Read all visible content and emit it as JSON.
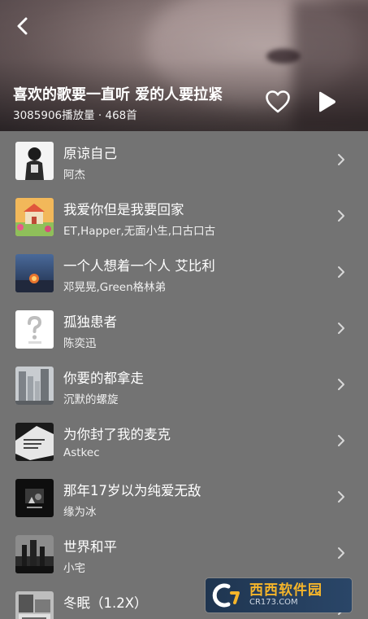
{
  "header": {
    "title": "喜欢的歌要一直听 爱的人要拉紧",
    "play_count": "3085906播放量",
    "separator": " · ",
    "track_count": "468首"
  },
  "songs": [
    {
      "title": "原谅自己",
      "artist": "阿杰"
    },
    {
      "title": "我爱你但是我要回家",
      "artist": "ET,Happer,无面小生,口古口古"
    },
    {
      "title": "一个人想着一个人 艾比利",
      "artist": "邓晃晃,Green格林弟"
    },
    {
      "title": "孤独患者",
      "artist": "陈奕迅"
    },
    {
      "title": "你要的都拿走",
      "artist": "沉默的螺旋"
    },
    {
      "title": "为你封了我的麦克",
      "artist": "Astkec"
    },
    {
      "title": "那年17岁以为纯爱无敌",
      "artist": "缘为冰"
    },
    {
      "title": "世界和平",
      "artist": "小宅"
    },
    {
      "title": "冬眠（1.2X）",
      "artist": ""
    }
  ],
  "watermark": {
    "main": "西西软件园",
    "sub": "CR173.COM"
  },
  "colors": {
    "list_background": "#737373",
    "watermark_accent": "#f5b52a"
  },
  "icons": [
    "back-arrow-icon",
    "heart-outline-icon",
    "play-icon",
    "chevron-right-icon"
  ]
}
